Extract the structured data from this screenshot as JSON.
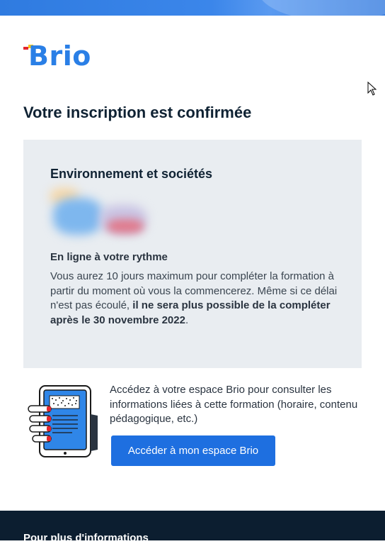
{
  "brand": {
    "logo_text": "Brio",
    "colors": {
      "primary": "#2a7fe6",
      "accent_red": "#e3262e",
      "accent_yellow": "#f5c51a",
      "footer": "#0c1e30"
    }
  },
  "header": {
    "title": "Votre inscription est confirmée"
  },
  "course": {
    "title": "Environnement et sociétés",
    "format_title": "En ligne à votre rythme",
    "description_before": "Vous aurez 10 jours maximum pour compléter la formation à partir du moment où vous la commencerez. Même si ce délai n'est pas écoulé, ",
    "description_bold": "il ne sera plus possible de la compléter après le 30 novembre 2022",
    "description_after": "."
  },
  "access": {
    "text": "Accédez à votre espace Brio pour consulter les informations liées à cette formation (horaire, contenu pédagogique, etc.)",
    "button_label": "Accéder à mon espace Brio"
  },
  "footer": {
    "heading": "Pour plus d'informations"
  }
}
